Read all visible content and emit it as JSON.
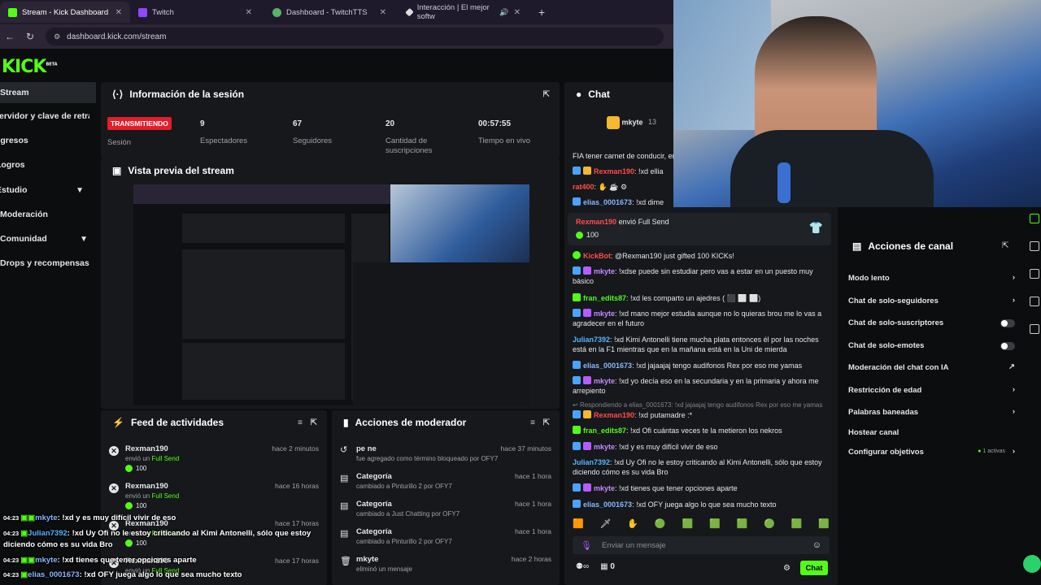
{
  "browser": {
    "tabs": [
      {
        "title": "Stream - Kick Dashboard"
      },
      {
        "title": "Twitch"
      },
      {
        "title": "Dashboard - TwitchTTS"
      },
      {
        "title": "Interacción | El mejor softw"
      }
    ],
    "new_tab": "+",
    "url": "dashboard.kick.com/stream"
  },
  "sidebar": {
    "logo": "KICK",
    "logo_tag": "BETA",
    "items": [
      {
        "label": "Stream"
      },
      {
        "label": "Servidor y clave de retransmisión"
      },
      {
        "label": "Ingresos"
      },
      {
        "label": "Logros"
      },
      {
        "label": "Estudio"
      },
      {
        "label": "Moderación"
      },
      {
        "label": "Comunidad"
      },
      {
        "label": "Drops y recompensas"
      }
    ]
  },
  "session": {
    "title": "Información de la sesión",
    "status_badge": "TRANSMITIENDO",
    "session_label": "Sesión",
    "stats": [
      {
        "value": "9",
        "label": "Espectadores"
      },
      {
        "value": "67",
        "label": "Seguidores"
      },
      {
        "value": "20",
        "label": "Cantidad de suscripciones"
      },
      {
        "value": "00:57:55",
        "label": "Tiempo en vivo"
      }
    ]
  },
  "preview": {
    "title": "Vista previa del stream"
  },
  "feed": {
    "title": "Feed de actividades",
    "items": [
      {
        "user": "Rexman190",
        "action": "envió un",
        "item": "Full Send",
        "amount": "100",
        "time": "hace 2 minutos"
      },
      {
        "user": "Rexman190",
        "action": "envió un",
        "item": "Full Send",
        "amount": "100",
        "time": "hace 16 horas"
      },
      {
        "user": "Rexman190",
        "action": "envió un",
        "item": "Full Send",
        "amount": "100",
        "time": "hace 17 horas"
      },
      {
        "user": "Rexman190",
        "action": "envió un",
        "item": "Full Send",
        "amount": "100",
        "time": "hace 17 horas"
      }
    ]
  },
  "modactions": {
    "title": "Acciones de moderador",
    "items": [
      {
        "title": "pe ne",
        "detail": "fue agregado como término bloqueado por OFY7",
        "time": "hace 37 minutos"
      },
      {
        "title": "Categoría",
        "detail": "cambiado a Pinturillo 2 por OFY7",
        "time": "hace 1 hora"
      },
      {
        "title": "Categoría",
        "detail": "cambiado a Just Chatting por OFY7",
        "time": "hace 1 hora"
      },
      {
        "title": "Categoría",
        "detail": "cambiado a Pinturillo 2 por OFY7",
        "time": "hace 1 hora"
      },
      {
        "title": "mkyte",
        "detail": "eliminó un mensaje",
        "time": "hace 2 horas"
      }
    ]
  },
  "chat": {
    "title": "Chat",
    "pinned_user": "mkyte",
    "pinned_count": "13",
    "messages": [
      {
        "user": "",
        "text": "FIA tener carnet de conducir, en"
      },
      {
        "user": "Rexman190",
        "text": ": !xd ellia"
      },
      {
        "user": "rat400",
        "text": ":"
      },
      {
        "user": "elias_0001673",
        "text": ": !xd dime"
      },
      {
        "user": "KickBot",
        "text": ": @Rexman190 just gifted 100 KICKs!"
      },
      {
        "user": "mkyte",
        "text": ": !xdse puede sin estudiar pero vas a estar en un puesto muy básico"
      },
      {
        "user": "fran_edits87",
        "text": ": !xd les comparto un ajedres ("
      },
      {
        "user": "mkyte",
        "text": ": !xd mano mejor estudia aunque no lo quieras brou me lo vas a agradecer en el futuro"
      },
      {
        "user": "Julian7392",
        "text": ": !xd Kimi Antonelli tiene mucha plata entonces él por las noches está en la F1 mientras que en la mañana está en la Uni de mierda"
      },
      {
        "user": "elias_0001673",
        "text": ": !xd jajaajaj tengo audifonos Rex por eso me yamas"
      },
      {
        "user": "mkyte",
        "text": ": !xd yo decía eso en la secundaria y en la primaria y ahora me arrepiento"
      },
      {
        "user": "Rexman190",
        "text": ": !xd putamadre :*"
      },
      {
        "user": "fran_edits87",
        "text": ": !xd Ofi cuántas veces te la metieron los nekros"
      },
      {
        "user": "mkyte",
        "text": ": !xd y es muy difícil vivir de eso"
      },
      {
        "user": "Julian7392",
        "text": ": !xd Uy Ofi no le estoy criticando al Kimi Antonelli, sólo que estoy diciendo cómo es su vida Bro"
      },
      {
        "user": "mkyte",
        "text": ": !xd tienes que tener opciones aparte"
      },
      {
        "user": "elias_0001673",
        "text": ": !xd OFY juega algo lo que sea mucho texto"
      }
    ],
    "gift": {
      "user": "Rexman190",
      "text": "envió Full Send",
      "amount": "100"
    },
    "reply_hint": "Respondiendo a elias_0001673: !xd jajaajaj tengo audifonos Rex por eso me yamas",
    "input_placeholder": "Enviar un mensaje",
    "counter": "0",
    "send_label": "Chat"
  },
  "channel_actions": {
    "title": "Acciones de canal",
    "rows": [
      {
        "label": "Modo lento"
      },
      {
        "label": "Chat de solo-seguidores"
      },
      {
        "label": "Chat de solo-suscriptores"
      },
      {
        "label": "Chat de solo-emotes"
      },
      {
        "label": "Moderación del chat con IA"
      },
      {
        "label": "Restricción de edad"
      },
      {
        "label": "Palabras baneadas"
      },
      {
        "label": "Hostear canal"
      },
      {
        "label": "Configurar objetivos",
        "extra": "1 activas"
      }
    ]
  },
  "overlay_chat": [
    {
      "time": "04:23",
      "user": "mkyte",
      "text": ": !xd y es muy difícil vivir de eso"
    },
    {
      "time": "04:23",
      "user": "Julian7392",
      "text": ": !xd Uy Ofi no le estoy criticando al Kimi Antonelli, sólo que estoy"
    },
    {
      "time": "",
      "user": "",
      "text": "diciendo cómo es su vida Bro"
    },
    {
      "time": "04:23",
      "user": "mkyte",
      "text": ": !xd tienes que tener opciones aparte"
    },
    {
      "time": "04:23",
      "user": "elias_0001673",
      "text": ": !xd OFY juega algo lo que sea mucho texto"
    }
  ],
  "colors": {
    "accent": "#53fc18",
    "live": "#e41d2a",
    "panel": "#16181b",
    "background": "#0b0d0f"
  }
}
